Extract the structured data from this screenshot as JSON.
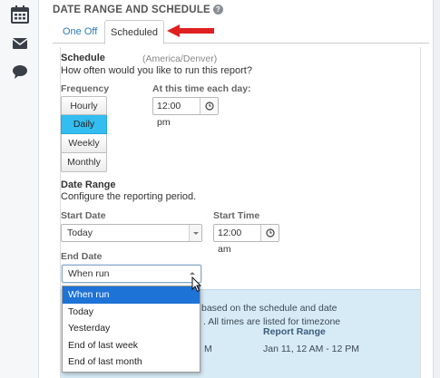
{
  "sidebar": {
    "icons": [
      "calendar-icon",
      "envelope-icon",
      "chat-bubble-icon"
    ]
  },
  "section": {
    "title": "DATE RANGE AND SCHEDULE",
    "help": "?"
  },
  "tabs": [
    {
      "label": "One Off"
    },
    {
      "label": "Scheduled"
    }
  ],
  "schedule": {
    "title": "Schedule",
    "timezone": "(America/Denver)",
    "description": "How often would you like to run this report?",
    "frequency_label": "Frequency",
    "frequency_options": [
      "Hourly",
      "Daily",
      "Weekly",
      "Monthly"
    ],
    "frequency_selected": "Daily",
    "time_label": "At this time each day:",
    "time_value": "12:00 pm"
  },
  "date_range": {
    "title": "Date Range",
    "description": "Configure the reporting period.",
    "start_date_label": "Start Date",
    "start_date_value": "Today",
    "start_time_label": "Start Time",
    "start_time_value": "12:00 am",
    "end_date_label": "End Date",
    "end_date_value": "When run",
    "end_date_options": [
      "When run",
      "Today",
      "Yesterday",
      "End of last week",
      "End of last month"
    ],
    "end_date_highlighted": "When run"
  },
  "info": {
    "line1": "based on the schedule and date",
    "line2": ". All times are listed for timezone",
    "report_range_header": "Report Range",
    "row_partial": "M",
    "row_range": "Jan 11, 12 AM - 12 PM"
  },
  "colors": {
    "accent_blue": "#2a7bbd",
    "active_frequency": "#33bdf0",
    "dropdown_highlight": "#1e73d6",
    "info_bg": "#d7ebf6",
    "annotation_arrow": "#e02020"
  }
}
